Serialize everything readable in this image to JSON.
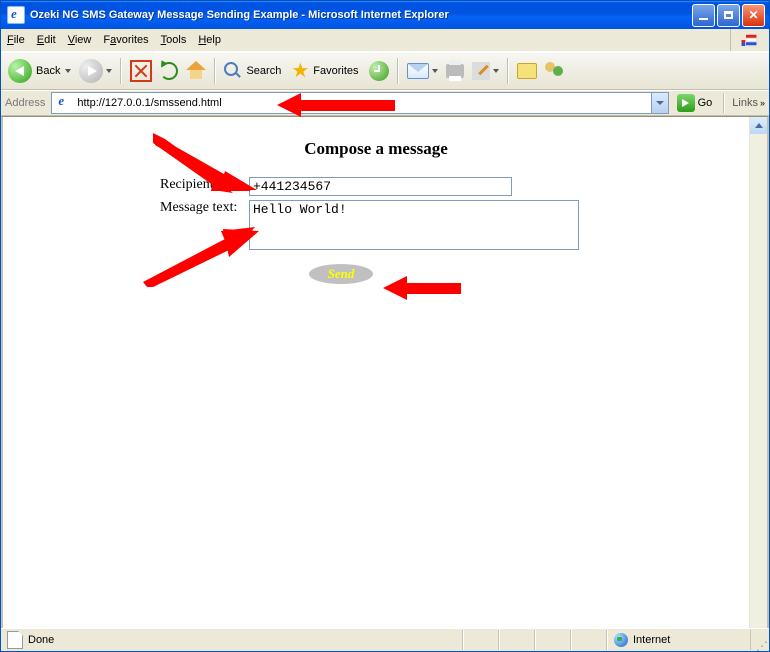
{
  "window": {
    "title": "Ozeki NG SMS Gateway Message Sending Example - Microsoft Internet Explorer"
  },
  "menu": {
    "file": "File",
    "edit": "Edit",
    "view": "View",
    "favorites": "Favorites",
    "tools": "Tools",
    "help": "Help"
  },
  "toolbar": {
    "back": "Back",
    "search": "Search",
    "favorites": "Favorites"
  },
  "address": {
    "label": "Address",
    "url": "http://127.0.0.1/smssend.html",
    "go": "Go",
    "links": "Links"
  },
  "page": {
    "heading": "Compose a message",
    "recipient_label": "Recipient:",
    "recipient_value": "+441234567",
    "message_label": "Message text:",
    "message_value": "Hello World!",
    "send_label": "Send"
  },
  "status": {
    "done": "Done",
    "zone": "Internet"
  }
}
